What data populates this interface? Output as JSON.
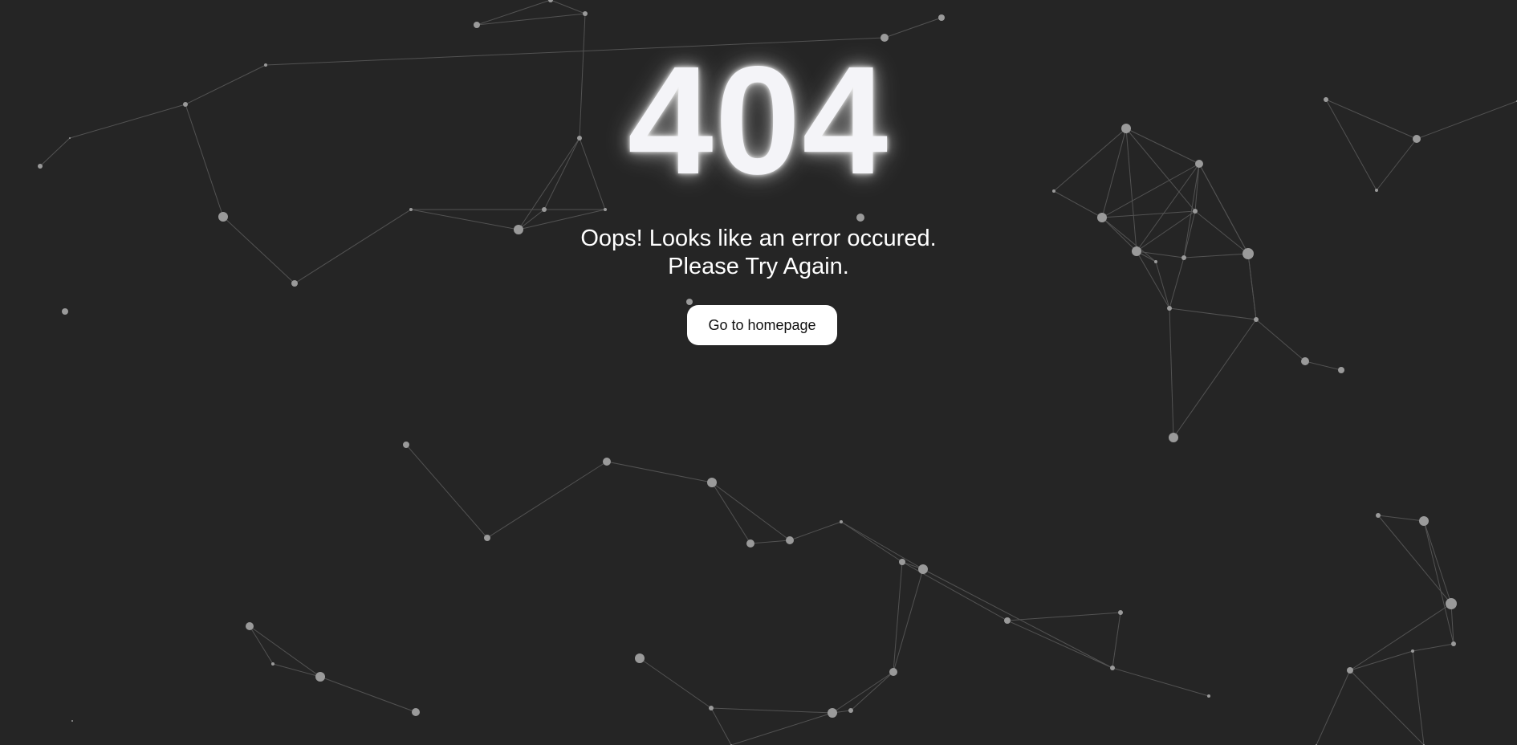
{
  "error": {
    "code": "404",
    "message_line1": "Oops! Looks like an error occured.",
    "message_line2": "Please Try Again.",
    "button_label": "Go to homepage"
  },
  "colors": {
    "background": "#252525",
    "text": "#ffffff",
    "button_bg": "#ffffff",
    "button_text": "#111111",
    "network_line": "#8a8a8a",
    "network_node": "#9a9a9a"
  }
}
